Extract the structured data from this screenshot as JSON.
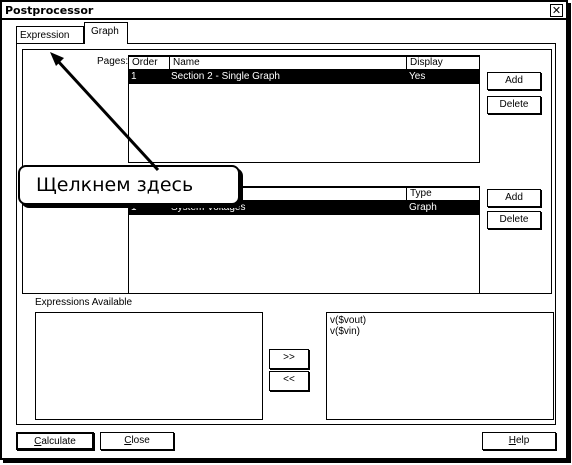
{
  "window": {
    "title": "Postprocessor",
    "close_glyph": "✕"
  },
  "tabs": [
    {
      "label": "Expression"
    },
    {
      "label": "Graph"
    }
  ],
  "pages": {
    "label": "Pages:",
    "columns": [
      "Order",
      "Name",
      "Display"
    ],
    "rows": [
      {
        "order": "1",
        "name": "Section 2 - Single Graph",
        "display": "Yes"
      }
    ],
    "add_label": "Add",
    "delete_label": "Delete"
  },
  "graphs": {
    "columns": [
      "Type"
    ],
    "rows": [
      {
        "order": "1",
        "name": "System Voltages",
        "type": "Graph"
      }
    ],
    "add_label": "Add",
    "delete_label": "Delete"
  },
  "expressions": {
    "label": "Expressions Available",
    "left_items": [],
    "right_items": [
      "v($vout)",
      "v($vin)"
    ],
    "move_right_label": ">>",
    "move_left_label": "<<"
  },
  "footer": {
    "calculate_prefix": "C",
    "calculate_rest": "alculate",
    "close_prefix": "C",
    "close_rest": "lose",
    "help_prefix": "H",
    "help_rest": "elp"
  },
  "callout": {
    "text": "Щелкнем здесь"
  }
}
